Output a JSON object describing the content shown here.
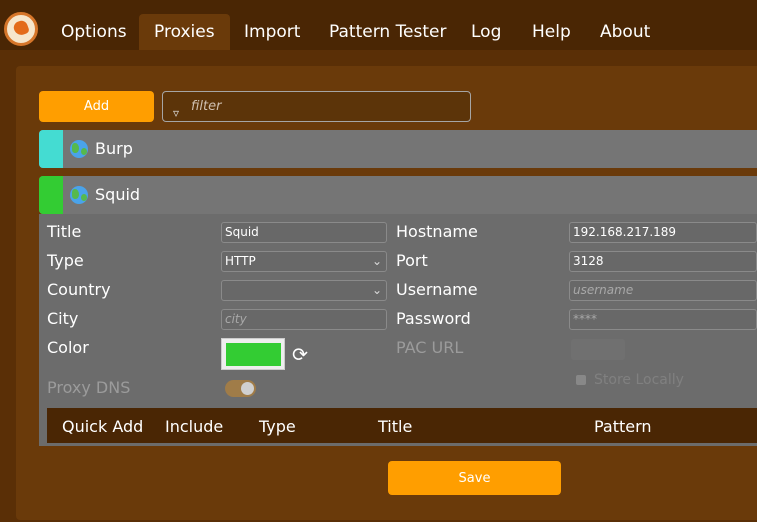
{
  "nav": {
    "logo_icon": "foxyproxy-logo",
    "tabs": [
      {
        "label": "Options",
        "active": false
      },
      {
        "label": "Proxies",
        "active": true
      },
      {
        "label": "Import",
        "active": false
      },
      {
        "label": "Pattern Tester",
        "active": false
      },
      {
        "label": "Log",
        "active": false
      },
      {
        "label": "Help",
        "active": false
      },
      {
        "label": "About",
        "active": false
      }
    ]
  },
  "toolbar": {
    "add_label": "Add",
    "filter_placeholder": "filter",
    "filter_icon": "funnel-icon"
  },
  "proxies": [
    {
      "title": "Burp",
      "color": "#44dcd2",
      "icon": "globe-icon",
      "expanded": false
    },
    {
      "title": "Squid",
      "color": "#33cc33",
      "icon": "globe-icon",
      "expanded": true
    }
  ],
  "form": {
    "title_label": "Title",
    "title_value": "Squid",
    "type_label": "Type",
    "type_value": "HTTP",
    "country_label": "Country",
    "country_value": "",
    "city_label": "City",
    "city_placeholder": "city",
    "color_label": "Color",
    "color_value": "#33cc33",
    "proxy_dns_label": "Proxy DNS",
    "proxy_dns_enabled": true,
    "hostname_label": "Hostname",
    "hostname_value": "192.168.217.189",
    "port_label": "Port",
    "port_value": "3128",
    "username_label": "Username",
    "username_placeholder": "username",
    "password_label": "Password",
    "password_placeholder": "****",
    "pac_url_label": "PAC URL",
    "store_locally_label": "Store Locally"
  },
  "patterns_table": {
    "columns": [
      "Quick Add",
      "Include",
      "Type",
      "Title",
      "Pattern"
    ]
  },
  "save_label": "Save",
  "colors": {
    "background": "#5a2f06",
    "accent": "#ff9e00",
    "panel": "#6c6c6c"
  }
}
